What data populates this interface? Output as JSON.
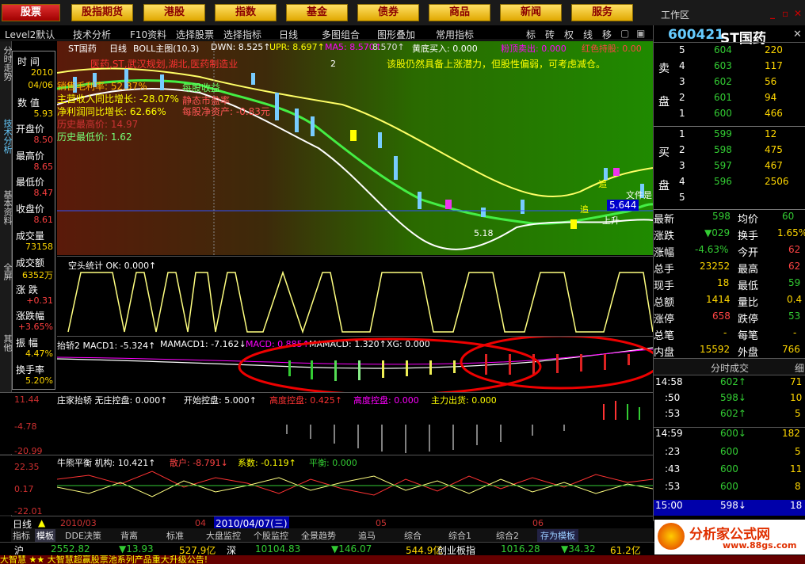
{
  "topnav": {
    "items": [
      "股票",
      "股指期货",
      "港股",
      "指数",
      "基金",
      "债券",
      "商品",
      "新闻",
      "服务"
    ],
    "workarea": "工作区"
  },
  "toolbar": {
    "items": [
      "Level2默认",
      "技术分析",
      "F10资料",
      "选择股票",
      "选择指标",
      "日线",
      "多图组合",
      "图形叠加",
      "常用指标",
      "标",
      "砖",
      "权",
      "线",
      "移"
    ]
  },
  "stock": {
    "code": "600421",
    "name": "ST国药"
  },
  "lefttabs": [
    "分时走势",
    "技术分析",
    "基本资料",
    "全屏",
    "其他"
  ],
  "infobox": {
    "time_label": "时 间",
    "time_val1": "2010",
    "time_val2": "04/06",
    "num_label": "数 值",
    "num_val": "5.93",
    "open_label": "开盘价",
    "open_val": "8.50",
    "high_label": "最高价",
    "high_val": "8.65",
    "low_label": "最低价",
    "low_val": "8.47",
    "close_label": "收盘价",
    "close_val": "8.61",
    "vol_label": "成交量",
    "vol_val": "73158",
    "amt_label": "成交额",
    "amt_val": "6352万",
    "chg_label": "涨 跌",
    "chg_val": "+0.31",
    "pct_label": "涨跌幅",
    "pct_val": "+3.65%",
    "amp_label": "振 幅",
    "amp_val": "4.47%",
    "turn_label": "换手率",
    "turn_val": "5.20%"
  },
  "main": {
    "title_stock": "ST国药",
    "title_period": "日线",
    "title_boll": "BOLL主图(10,3)",
    "title_dwn": "DWN: 8.525↑",
    "title_upr": "UPR: 8.697↑",
    "title_ma5": "MA5: 8.570↑",
    "title_val": "8.570↑",
    "title_hd": "黄底买入: 0.000",
    "title_fd": "粉顶卖出: 0.000",
    "title_hs": "红色持股: 0.00",
    "notice": "该股仍然具备上涨潜力，但股性偏弱，可考虑减仓。",
    "left_tags": "医药,ST,武汉规划,湖北,医药制造业",
    "info1": "销售毛利率: 52.37%",
    "info2": "主营收入同比增长: -28.07%",
    "info3": "净利润同比增长: 62.66%",
    "info4": "历史最高价: 14.97",
    "info5": "历史最低价: 1.62",
    "info6": "每股收益",
    "info7": "静态市盈率",
    "info8": "每股净资产: -0.83元",
    "price_tag": "5.644",
    "marker_up": "上升",
    "marker_zhui": "追",
    "marker_val": "5.18",
    "marker_2": "2",
    "marker_rise": "上升",
    "marker_trend": "文件是"
  },
  "pane2": {
    "title": "空头统计 OK: 0.000↑"
  },
  "pane3": {
    "title": "抬轿2 MACD1: -5.324↑",
    "title2": "MAMACD1: -7.162↓",
    "title3": "MACD: 0.885↑",
    "title4": "MAMACD: 1.320↑",
    "title5": "XG: 0.000"
  },
  "pane4": {
    "title": "庄家抬轿 无庄控盘: 0.000↑",
    "title2": "开始控盘: 5.000↑",
    "title3": "高度控盘: 0.425↑",
    "title4": "高度控盘: 0.000",
    "title5": "主力出货: 0.000",
    "y1": "11.44",
    "y2": "-4.78",
    "y3": "-20.99"
  },
  "pane5": {
    "title": "牛熊平衡 机构: 10.421↑",
    "title2": "散户: -8.791↓",
    "title3": "系数: -0.119↑",
    "title4": "平衡: 0.000",
    "y1": "22.35",
    "y2": "0.17",
    "y3": "-22.01"
  },
  "xaxis": {
    "period": "日线",
    "m1": "2010/03",
    "m2": "04",
    "cursor": "2010/04/07(三)",
    "m3": "05",
    "m4": "06"
  },
  "bottomtabs": [
    "指标",
    "模板",
    "DDE决策",
    "背离",
    "标准",
    "大盘监控",
    "个股监控",
    "全景趋势",
    "追马",
    "综合",
    "综合1",
    "综合2",
    "存为模板"
  ],
  "index": {
    "sh_label": "沪",
    "sh_val": "2552.82",
    "sh_chg": "▼13.93",
    "sh_amt": "527.9亿",
    "sz_label": "深",
    "sz_val": "10104.83",
    "sz_chg": "▼146.07",
    "sz_amt": "544.9亿",
    "cy_label": "创业板指",
    "cy_val": "1016.28",
    "cy_chg": "▼34.32",
    "cy_amt": "61.2亿"
  },
  "ticker": "大智慧  ★★ 大智慧超赢股票池系列产品重大升级公告!",
  "orderbook": {
    "sell": [
      {
        "l": "5",
        "p": "604",
        "v": "220"
      },
      {
        "l": "4",
        "p": "603",
        "v": "117"
      },
      {
        "l": "3",
        "p": "602",
        "v": "56"
      },
      {
        "l": "2",
        "p": "601",
        "v": "94"
      },
      {
        "l": "1",
        "p": "600",
        "v": "466"
      }
    ],
    "buy": [
      {
        "l": "1",
        "p": "599",
        "v": "12"
      },
      {
        "l": "2",
        "p": "598",
        "v": "475"
      },
      {
        "l": "3",
        "p": "597",
        "v": "467"
      },
      {
        "l": "4",
        "p": "596",
        "v": "2506"
      },
      {
        "l": "5",
        "p": "",
        "v": ""
      }
    ],
    "sell_label_a": "卖",
    "sell_label_b": "盘",
    "buy_label_a": "买",
    "buy_label_b": "盘"
  },
  "quote": [
    {
      "a": "最新",
      "av": "598",
      "b": "均价",
      "bv": "60"
    },
    {
      "a": "涨跌",
      "av": "▼029",
      "b": "换手",
      "bv": "1.65%"
    },
    {
      "a": "涨幅",
      "av": "-4.63%",
      "b": "今开",
      "bv": "62"
    },
    {
      "a": "总手",
      "av": "23252",
      "b": "最高",
      "bv": "62"
    },
    {
      "a": "现手",
      "av": "18",
      "b": "最低",
      "bv": "59"
    },
    {
      "a": "总额",
      "av": "1414",
      "b": "量比",
      "bv": "0.4"
    },
    {
      "a": "涨停",
      "av": "658",
      "b": "跌停",
      "bv": "53"
    },
    {
      "a": "总笔",
      "av": "-",
      "b": "每笔",
      "bv": "-"
    },
    {
      "a": "内盘",
      "av": "15592",
      "b": "外盘",
      "bv": "766"
    }
  ],
  "trades_header": "分时成交",
  "trades_header2": "细",
  "trades": [
    {
      "t": "14:58",
      "p": "602↑",
      "v": "71"
    },
    {
      "t": ":50",
      "p": "598↓",
      "v": "10"
    },
    {
      "t": ":53",
      "p": "602↑",
      "v": "5"
    },
    {
      "t": "14:59",
      "p": "600↓",
      "v": "182"
    },
    {
      "t": ":23",
      "p": "600",
      "v": "5"
    },
    {
      "t": ":43",
      "p": "600",
      "v": "11"
    },
    {
      "t": ":53",
      "p": "600",
      "v": "8"
    },
    {
      "t": "15:00",
      "p": "598↓",
      "v": "18"
    }
  ],
  "watermark": "分析家公式网",
  "watermark_url": "www.88gs.com"
}
